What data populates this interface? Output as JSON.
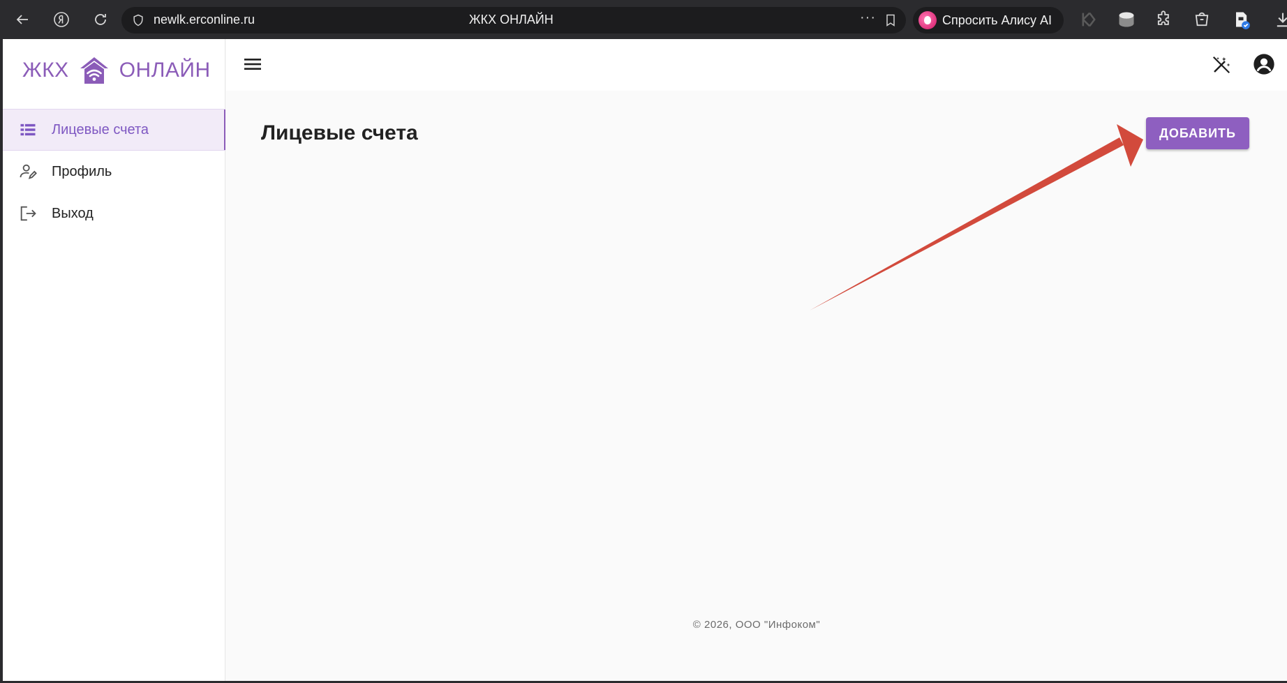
{
  "browser": {
    "url": "newlk.erconline.ru",
    "tab_title": "ЖКХ ОНЛАЙН",
    "more": "···",
    "alice_label": "Спросить Алису AI"
  },
  "app": {
    "logo_left": "ЖКХ",
    "logo_right": "ОНЛАЙН",
    "accent_color": "#8b5cb8"
  },
  "sidebar": {
    "items": [
      {
        "label": "Лицевые счета",
        "icon": "list-icon",
        "active": true
      },
      {
        "label": "Профиль",
        "icon": "person-edit-icon",
        "active": false
      },
      {
        "label": "Выход",
        "icon": "logout-icon",
        "active": false
      }
    ]
  },
  "main": {
    "title": "Лицевые счета",
    "add_label": "ДОБАВИТЬ"
  },
  "footer": {
    "text": "© 2026, ООО \"Инфоком\""
  },
  "annotation": {
    "arrow_color": "#d24a3c"
  }
}
